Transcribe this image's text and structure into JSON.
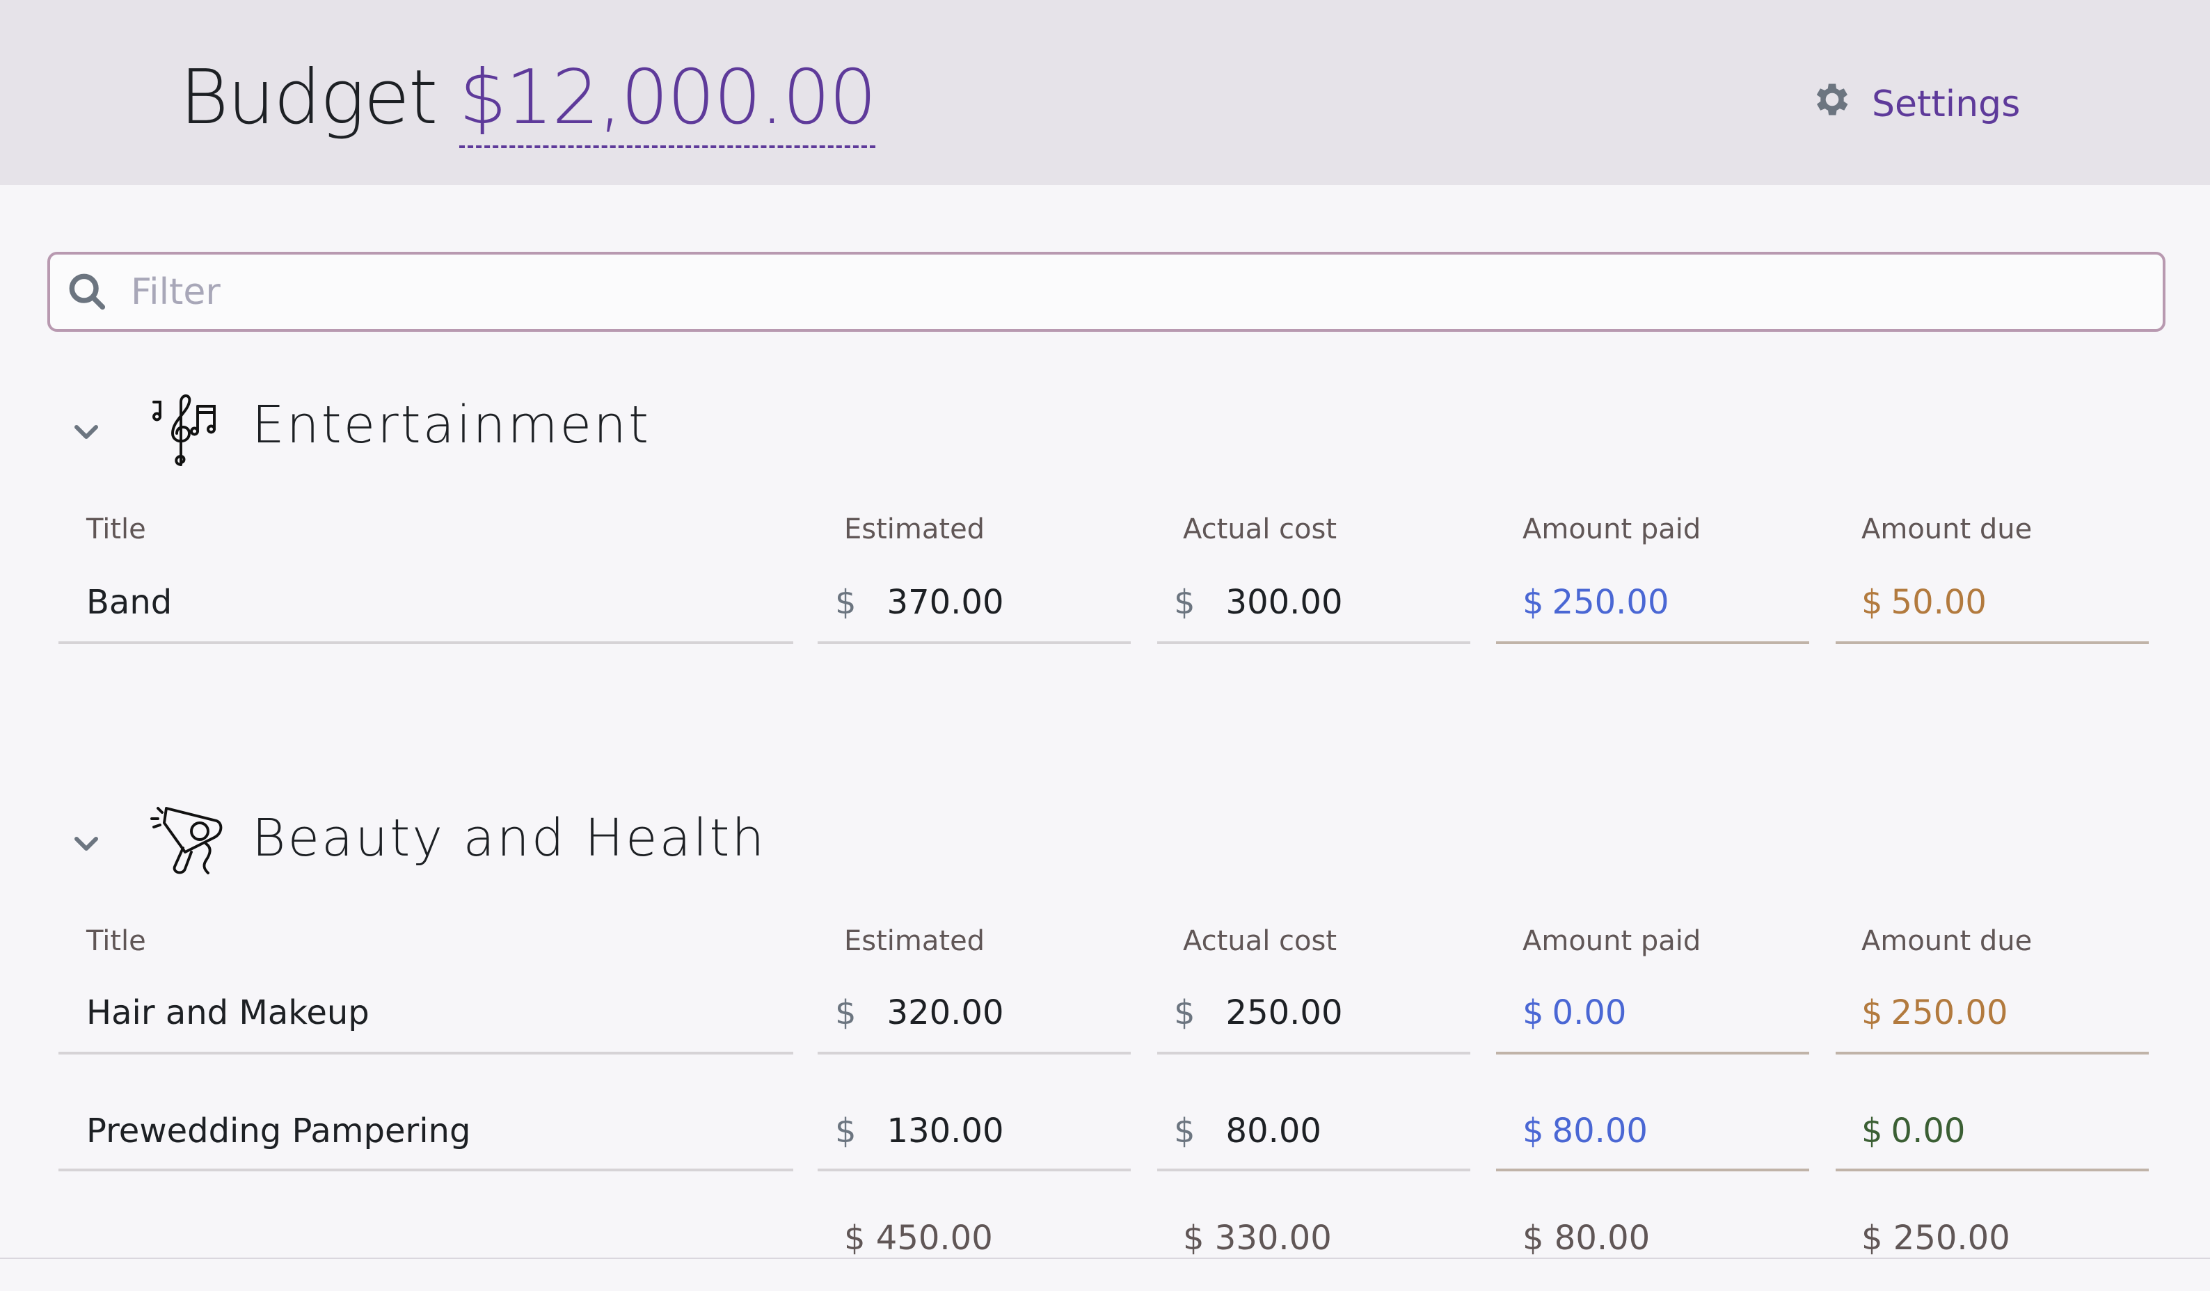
{
  "header": {
    "budget_label": "Budget",
    "budget_amount": "$12,000.00",
    "settings_label": "Settings"
  },
  "filter": {
    "placeholder": "Filter",
    "value": ""
  },
  "columns": {
    "title": "Title",
    "estimated": "Estimated",
    "actual": "Actual cost",
    "paid": "Amount paid",
    "due": "Amount due"
  },
  "currency_symbol": "$",
  "colors": {
    "accent": "#5e3a9a",
    "paid": "#4a67d4",
    "due": "#b27a3e",
    "due_zero": "#3b5f34"
  },
  "categories": [
    {
      "name": "Entertainment",
      "icon": "music-notes-icon",
      "items": [
        {
          "title": "Band",
          "estimated": "370.00",
          "actual": "300.00",
          "paid": "250.00",
          "due": "50.00"
        }
      ]
    },
    {
      "name": "Beauty and Health",
      "icon": "hair-dryer-icon",
      "items": [
        {
          "title": "Hair and Makeup",
          "estimated": "320.00",
          "actual": "250.00",
          "paid": "0.00",
          "due": "250.00"
        },
        {
          "title": "Prewedding Pampering",
          "estimated": "130.00",
          "actual": "80.00",
          "paid": "80.00",
          "due": "0.00"
        }
      ],
      "totals": {
        "estimated": "$ 450.00",
        "actual": "$ 330.00",
        "paid": "$ 80.00",
        "due": "$ 250.00"
      }
    }
  ]
}
